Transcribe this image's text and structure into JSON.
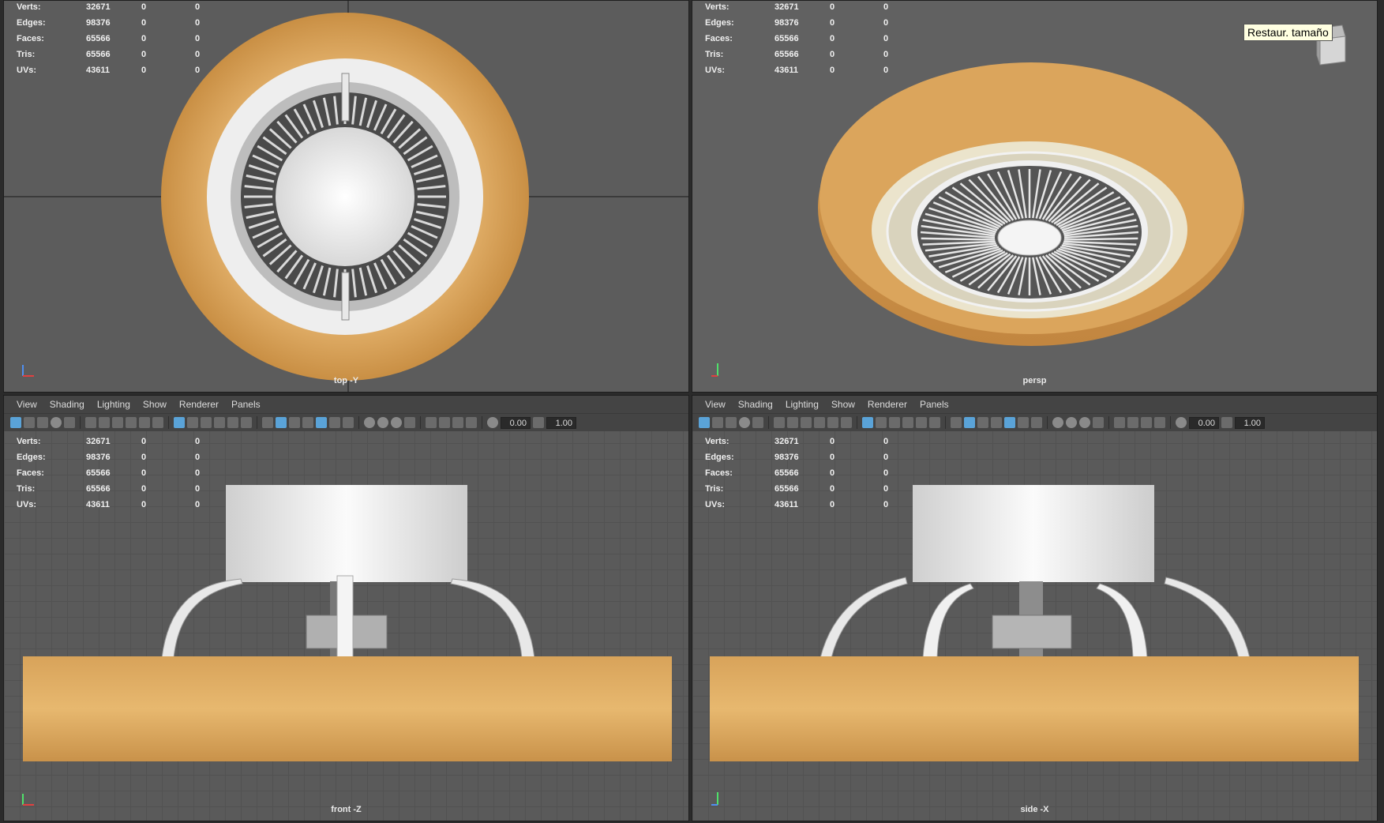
{
  "hud_stats": [
    {
      "label": "Verts:",
      "value": "32671",
      "a": "0",
      "b": "0"
    },
    {
      "label": "Edges:",
      "value": "98376",
      "a": "0",
      "b": "0"
    },
    {
      "label": "Faces:",
      "value": "65566",
      "a": "0",
      "b": "0"
    },
    {
      "label": "Tris:",
      "value": "65566",
      "a": "0",
      "b": "0"
    },
    {
      "label": "UVs:",
      "value": "43611",
      "a": "0",
      "b": "0"
    }
  ],
  "menu": {
    "view": "View",
    "shading": "Shading",
    "lighting": "Lighting",
    "show": "Show",
    "renderer": "Renderer",
    "panels": "Panels"
  },
  "toolbar": {
    "near_value": "0.00",
    "far_value": "1.00"
  },
  "cameras": {
    "top": "top -Y",
    "persp": "persp",
    "front": "front -Z",
    "side": "side -X"
  },
  "tooltip": "Restaur. tamaño",
  "colors": {
    "wood": "#d9a45a",
    "viewport_bg": "#5c5c5c",
    "highlight": "#5aa3d8"
  }
}
